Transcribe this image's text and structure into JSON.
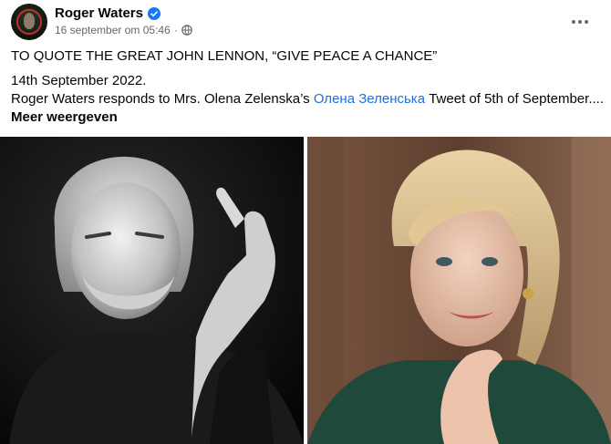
{
  "post": {
    "author": "Roger Waters",
    "timestamp": "16 september om 05:46",
    "verified": true,
    "lines": {
      "headline": "TO QUOTE THE GREAT JOHN LENNON, “GIVE PEACE A CHANCE”",
      "date": "14th September 2022.",
      "body_prefix": "Roger Waters responds to Mrs. Olena Zelenska’s ",
      "mention": "Олена Зеленська",
      "body_suffix": " Tweet of 5th of September....",
      "see_more": "Meer weergeven"
    }
  },
  "icons": {
    "verified": "verified-badge-icon",
    "audience": "globe-icon",
    "menu": "more-options-icon"
  },
  "colors": {
    "link": "#216fdb",
    "secondary_text": "#65676b",
    "verified_badge": "#1877f2"
  }
}
